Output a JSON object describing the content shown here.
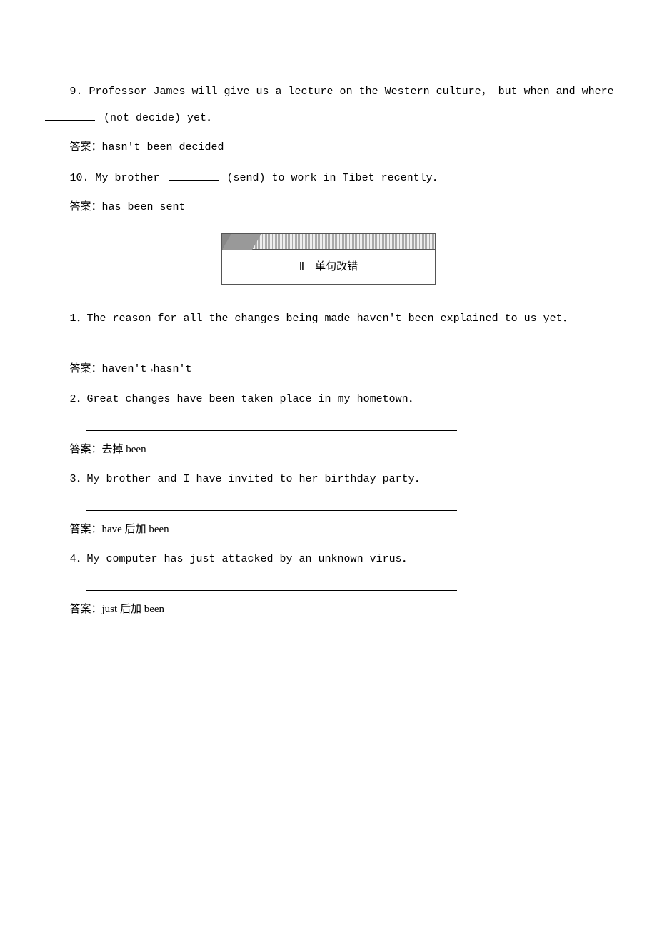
{
  "items": {
    "q9_text_a": "9. Professor James will give us a lecture on the Western culture， but when and where ",
    "q9_text_b": " (not decide) yet．",
    "a9_label": "答案：",
    "a9_value": "hasn't been decided",
    "q10_text_a": "10. My brother ",
    "q10_text_b": " (send) to work in Tibet recently．",
    "a10_label": "答案：",
    "a10_value": "has been sent"
  },
  "section2": {
    "title": "Ⅱ　单句改错"
  },
  "errors": {
    "q1": "1．The reason for all the changes being made haven't been explained to us yet．",
    "a1_label": "答案：",
    "a1_value": "haven't→hasn't",
    "q2": "2．Great changes have been taken place in my hometown．",
    "a2_label": "答案：",
    "a2_value": "去掉 been",
    "q3": "3．My brother and I have invited to her birthday party．",
    "a3_label": "答案：",
    "a3_value": "have 后加 been",
    "q4": "4．My computer has just attacked by an unknown virus．",
    "a4_label": "答案：",
    "a4_value": "just 后加 been"
  }
}
